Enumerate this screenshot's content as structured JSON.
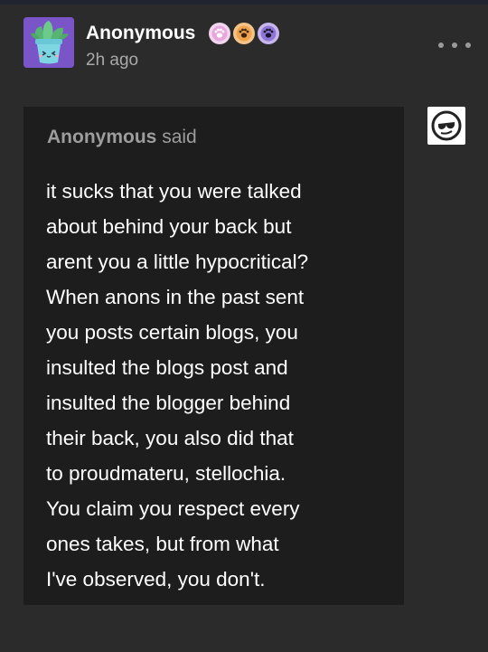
{
  "post": {
    "author_name": "Anonymous",
    "timestamp": "2h ago",
    "badges": [
      "paw-badge-pink",
      "paw-badge-orange",
      "paw-badge-purple"
    ],
    "more_icon": "more-options-icon"
  },
  "ask": {
    "asker_name": "Anonymous",
    "said_label": "said",
    "lines": [
      "it sucks that you were talked",
      "about behind your back but",
      "arent you a little hypocritical?",
      "When anons in the past sent",
      "you posts certain blogs, you",
      "insulted the blogs post and",
      "insulted the blogger behind",
      "their back, you also did that",
      "to proudmateru, stellochia.",
      "You claim you respect every",
      "ones takes, but from what",
      "I've observed, you don't."
    ]
  },
  "colors": {
    "background": "#2b2b2b",
    "ask_box": "#1d1d1d",
    "avatar_bg": "#7a55c8",
    "text_primary": "#ffffff",
    "text_secondary": "#a9a9a9"
  }
}
